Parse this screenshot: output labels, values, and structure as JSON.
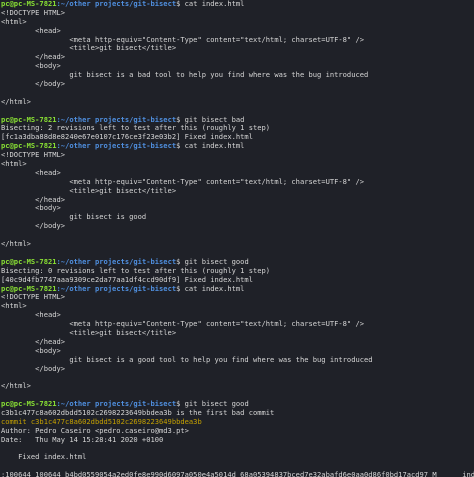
{
  "terminal": {
    "colors": {
      "background": "#1f2128",
      "text": "#d6d6d6",
      "prompt_user": "#8ae234",
      "prompt_path": "#4f8fdf",
      "commit_hash": "#c4a000"
    },
    "lines": [
      {
        "type": "prompt",
        "user": "pc@pc-MS-7821",
        "path": ":~/other projects/git-bisect",
        "cmd": "$ cat index.html"
      },
      {
        "type": "text",
        "text": "<!DOCTYPE HTML>"
      },
      {
        "type": "text",
        "text": "<html>"
      },
      {
        "type": "text",
        "text": "        <head>"
      },
      {
        "type": "text",
        "text": "                <meta http-equiv=\"Content-Type\" content=\"text/html; charset=UTF-8\" />"
      },
      {
        "type": "text",
        "text": "                <title>git bisect</title>"
      },
      {
        "type": "text",
        "text": "        </head>"
      },
      {
        "type": "text",
        "text": "        <body>"
      },
      {
        "type": "text",
        "text": "                git bisect is a bad tool to help you find where was the bug introduced"
      },
      {
        "type": "text",
        "text": "        </body>"
      },
      {
        "type": "text",
        "text": ""
      },
      {
        "type": "text",
        "text": "</html>"
      },
      {
        "type": "text",
        "text": ""
      },
      {
        "type": "prompt",
        "user": "pc@pc-MS-7821",
        "path": ":~/other projects/git-bisect",
        "cmd": "$ git bisect bad"
      },
      {
        "type": "text",
        "text": "Bisecting: 2 revisions left to test after this (roughly 1 step)"
      },
      {
        "type": "text",
        "text": "[fc1a3dba88d8e8240e67e0107c176ce3f23e03b2] Fixed index.html"
      },
      {
        "type": "prompt",
        "user": "pc@pc-MS-7821",
        "path": ":~/other projects/git-bisect",
        "cmd": "$ cat index.html"
      },
      {
        "type": "text",
        "text": "<!DOCTYPE HTML>"
      },
      {
        "type": "text",
        "text": "<html>"
      },
      {
        "type": "text",
        "text": "        <head>"
      },
      {
        "type": "text",
        "text": "                <meta http-equiv=\"Content-Type\" content=\"text/html; charset=UTF-8\" />"
      },
      {
        "type": "text",
        "text": "                <title>git bisect</title>"
      },
      {
        "type": "text",
        "text": "        </head>"
      },
      {
        "type": "text",
        "text": "        <body>"
      },
      {
        "type": "text",
        "text": "                git bisect is good"
      },
      {
        "type": "text",
        "text": "        </body>"
      },
      {
        "type": "text",
        "text": ""
      },
      {
        "type": "text",
        "text": "</html>"
      },
      {
        "type": "text",
        "text": ""
      },
      {
        "type": "prompt",
        "user": "pc@pc-MS-7821",
        "path": ":~/other projects/git-bisect",
        "cmd": "$ git bisect good"
      },
      {
        "type": "text",
        "text": "Bisecting: 0 revisions left to test after this (roughly 1 step)"
      },
      {
        "type": "text",
        "text": "[40c9d4fb7747aaa9309ce2da77aa1df4ccd90df9] Fixed index.html"
      },
      {
        "type": "prompt",
        "user": "pc@pc-MS-7821",
        "path": ":~/other projects/git-bisect",
        "cmd": "$ cat index.html"
      },
      {
        "type": "text",
        "text": "<!DOCTYPE HTML>"
      },
      {
        "type": "text",
        "text": "<html>"
      },
      {
        "type": "text",
        "text": "        <head>"
      },
      {
        "type": "text",
        "text": "                <meta http-equiv=\"Content-Type\" content=\"text/html; charset=UTF-8\" />"
      },
      {
        "type": "text",
        "text": "                <title>git bisect</title>"
      },
      {
        "type": "text",
        "text": "        </head>"
      },
      {
        "type": "text",
        "text": "        <body>"
      },
      {
        "type": "text",
        "text": "                git bisect is a good tool to help you find where was the bug introduced"
      },
      {
        "type": "text",
        "text": "        </body>"
      },
      {
        "type": "text",
        "text": ""
      },
      {
        "type": "text",
        "text": "</html>"
      },
      {
        "type": "text",
        "text": ""
      },
      {
        "type": "prompt",
        "user": "pc@pc-MS-7821",
        "path": ":~/other projects/git-bisect",
        "cmd": "$ git bisect good"
      },
      {
        "type": "text",
        "text": "c3b1c477c8a602dbdd5102c2698223649bbdea3b is the first bad commit"
      },
      {
        "type": "commit",
        "text": "commit c3b1c477c8a602dbdd5102c2698223649bbdea3b"
      },
      {
        "type": "text",
        "text": "Author: Pedro Caseiro <pedro.caseiro@md3.pt>"
      },
      {
        "type": "text",
        "text": "Date:   Thu May 14 15:28:41 2020 +0100"
      },
      {
        "type": "text",
        "text": ""
      },
      {
        "type": "text",
        "text": "    Fixed index.html"
      },
      {
        "type": "text",
        "text": ""
      },
      {
        "type": "text",
        "text": ":100644 100644 b4bd0559054a2ed0fe8e990d6097a050e4a5014d 68a05394837bced7e32abafd6e0aa0d86f0bd17acd97 M      index.html"
      }
    ]
  }
}
